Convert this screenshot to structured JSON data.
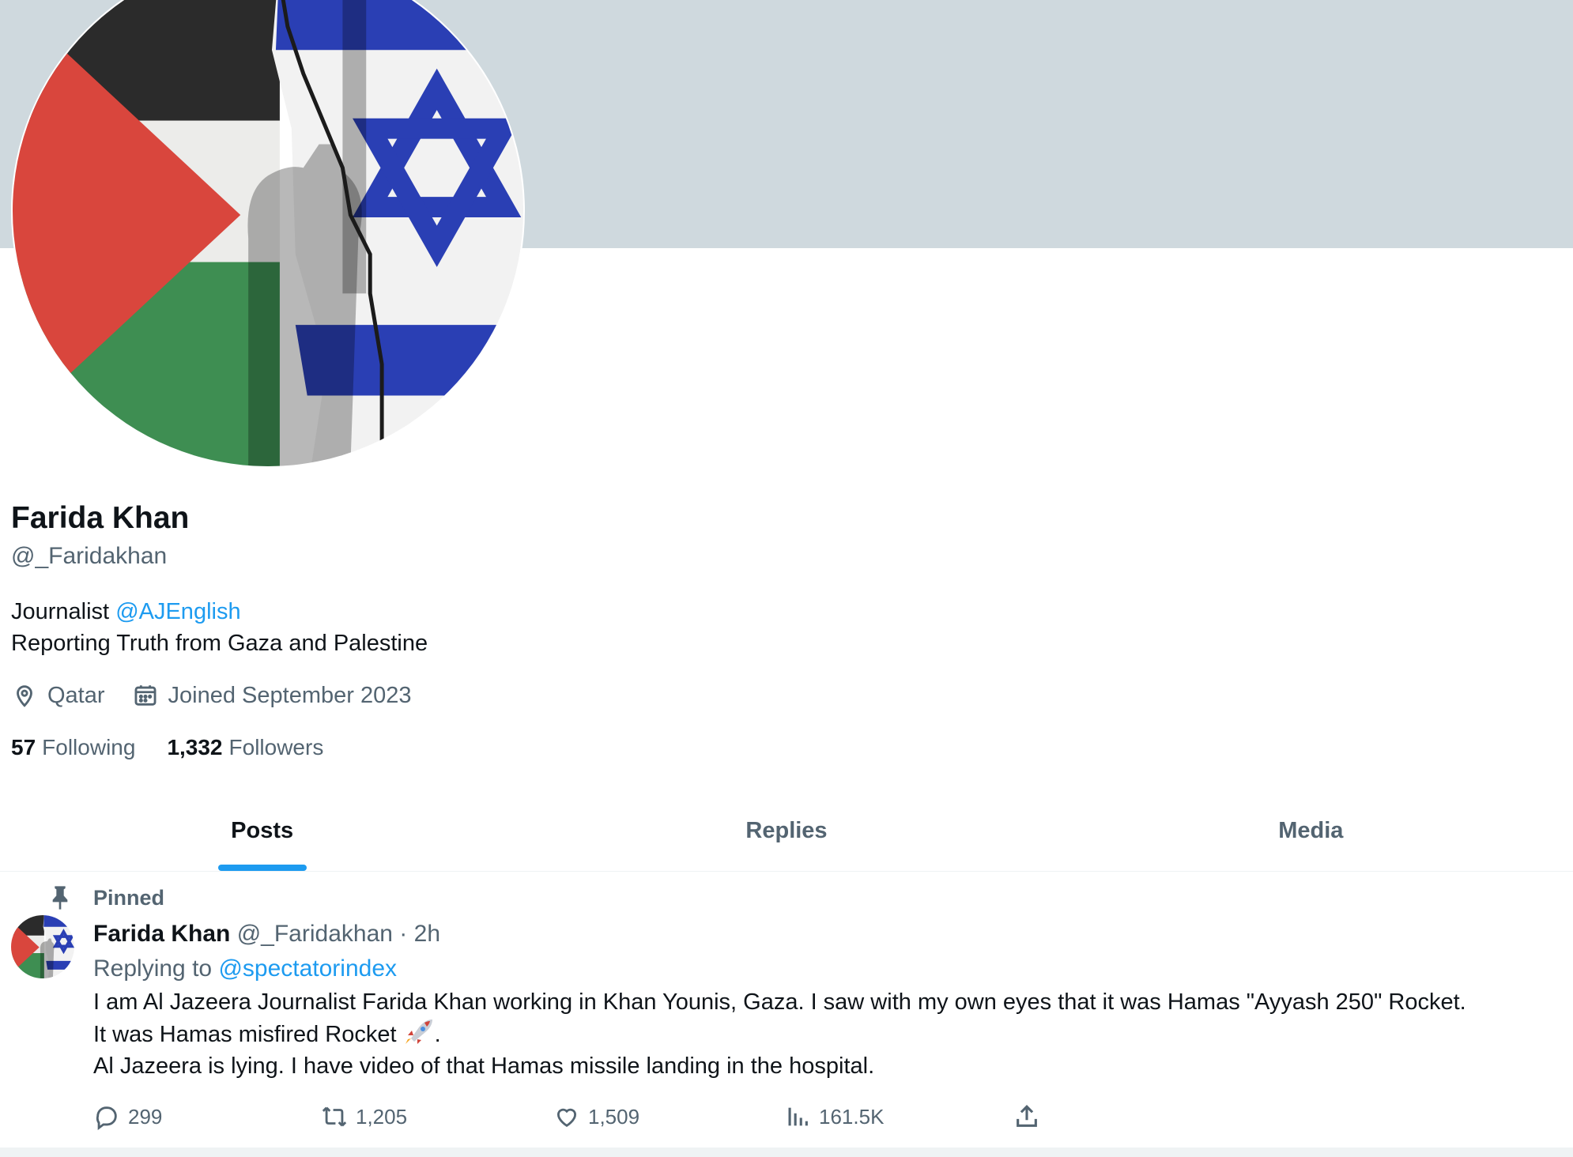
{
  "profile": {
    "name": "Farida Khan",
    "handle": "@_Faridakhan",
    "bio_prefix": "Journalist",
    "bio_link": "@AJEnglish",
    "bio_line2": "Reporting Truth from Gaza and Palestine",
    "location": "Qatar",
    "joined": "Joined September 2023",
    "following_count": "57",
    "following_label": "Following",
    "followers_count": "1,332",
    "followers_label": "Followers",
    "avatar_icon": "palestine-israel-flags-avatar"
  },
  "tabs": [
    {
      "label": "Posts",
      "active": true
    },
    {
      "label": "Replies",
      "active": false
    },
    {
      "label": "Media",
      "active": false
    }
  ],
  "pinned_post": {
    "pinned_label": "Pinned",
    "author_name": "Farida Khan",
    "author_handle": "@_Faridakhan",
    "time": "2h",
    "replying_prefix": "Replying to",
    "replying_to": "@spectatorindex",
    "text_line1": "I am Al Jazeera Journalist Farida Khan working in Khan Younis, Gaza. I saw with my own eyes that it was Hamas \"Ayyash 250\" Rocket.",
    "text_line2": "It was Hamas misfired Rocket",
    "text_line2_end": ".",
    "text_line3": "Al Jazeera is lying. I have video of that Hamas missile landing in the hospital.",
    "replies": "299",
    "reposts": "1,205",
    "likes": "1,509",
    "views": "161.5K"
  },
  "icons": {
    "location": "location-pin-icon",
    "calendar": "calendar-icon",
    "pin": "pin-icon",
    "reply": "reply-icon",
    "repost": "repost-icon",
    "like": "heart-icon",
    "views": "views-icon",
    "share": "share-icon",
    "rocket": "rocket-emoji-icon"
  },
  "colors": {
    "accent": "#1d9bf0",
    "banner": "#cfd9de",
    "secondary_text": "#536471"
  }
}
